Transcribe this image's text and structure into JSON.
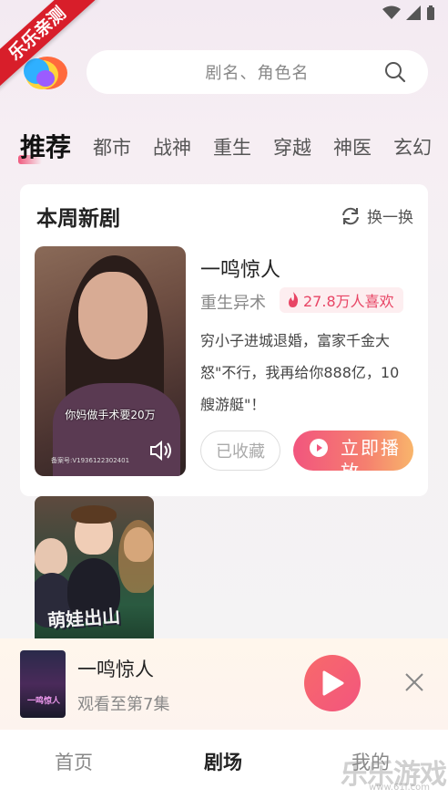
{
  "status_bar": {
    "icons": [
      "wifi-icon",
      "signal-icon",
      "battery-icon"
    ]
  },
  "ribbon": {
    "text": "乐乐亲测"
  },
  "search": {
    "placeholder": "剧名、角色名"
  },
  "tabs": [
    {
      "label": "推荐",
      "active": true
    },
    {
      "label": "都市"
    },
    {
      "label": "战神"
    },
    {
      "label": "重生"
    },
    {
      "label": "穿越"
    },
    {
      "label": "神医"
    },
    {
      "label": "玄幻"
    }
  ],
  "weekly": {
    "title": "本周新剧",
    "refresh_label": "换一换",
    "featured": {
      "title": "一鸣惊人",
      "genre": "重生异术",
      "likes": "27.8万人喜欢",
      "description": "穷小子进城退婚，富家千金大怒\"不行，我再给你888亿，10艘游艇\"！",
      "poster_subtitle": "你妈做手术要20万",
      "poster_record": "备案号:V1936122302401",
      "collected_label": "已收藏",
      "play_label": "立即播放"
    },
    "second_poster_title": "萌娃出山"
  },
  "mini_player": {
    "title": "一鸣惊人",
    "progress": "观看至第7集",
    "thumb_text": "一鸣惊人"
  },
  "nav": [
    {
      "label": "首页"
    },
    {
      "label": "剧场",
      "active": true
    },
    {
      "label": "我的"
    }
  ],
  "watermark": {
    "text": "乐乐游戏",
    "url": "www.61l.com"
  },
  "colors": {
    "accent": "#f2557e",
    "like": "#e84565",
    "ribbon": "#d81e2a"
  }
}
